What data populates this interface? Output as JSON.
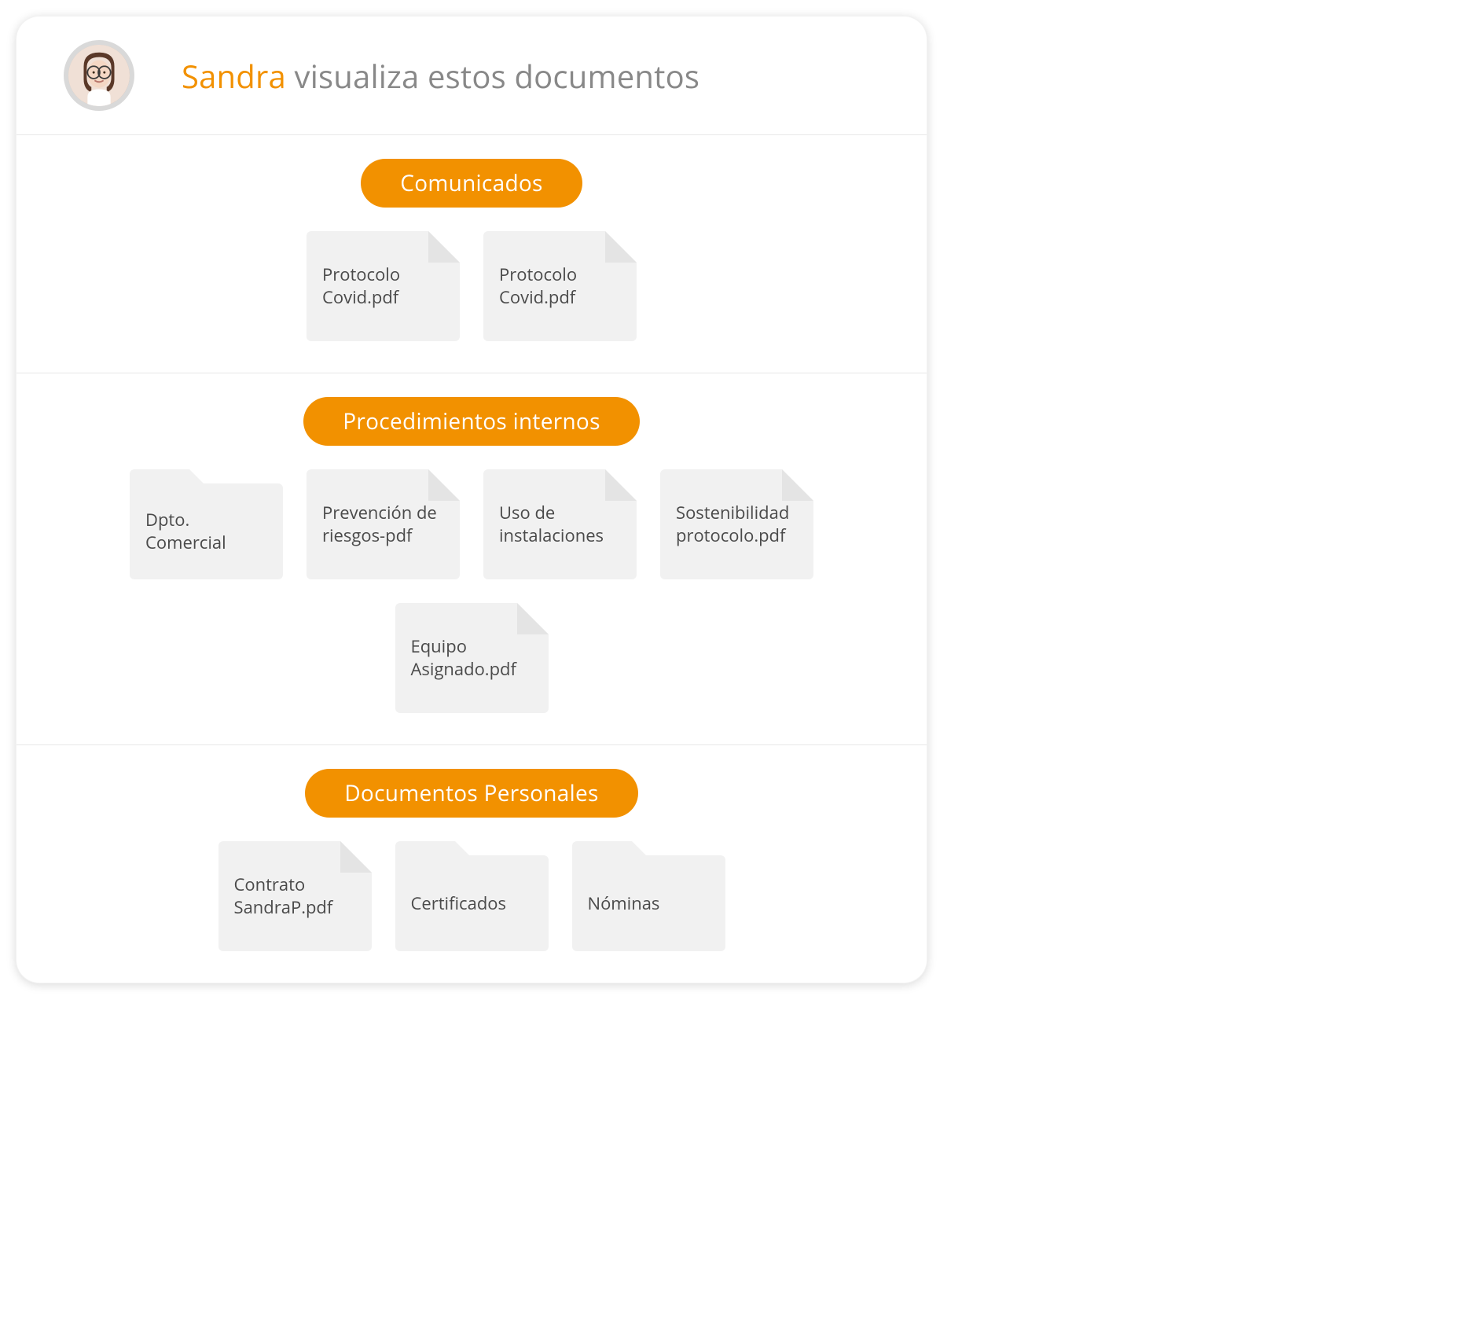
{
  "header": {
    "name": "Sandra",
    "rest": " visualiza estos documentos"
  },
  "sections": [
    {
      "title": "Comunicados",
      "items": [
        {
          "type": "file",
          "label": "Protocolo Covid.pdf"
        },
        {
          "type": "file",
          "label": "Protocolo Covid.pdf"
        }
      ]
    },
    {
      "title": "Procedimientos internos",
      "items": [
        {
          "type": "folder",
          "label": "Dpto. Comercial"
        },
        {
          "type": "file",
          "label": "Prevención de riesgos-pdf"
        },
        {
          "type": "file",
          "label": "Uso de instalaciones"
        },
        {
          "type": "file",
          "label": "Sostenibilidad protocolo.pdf"
        },
        {
          "type": "file",
          "label": "Equipo Asignado.pdf"
        }
      ]
    },
    {
      "title": "Documentos Personales",
      "items": [
        {
          "type": "file",
          "label": "Contrato SandraP.pdf"
        },
        {
          "type": "folder",
          "label": "Certificados"
        },
        {
          "type": "folder",
          "label": "Nóminas"
        }
      ]
    }
  ],
  "colors": {
    "accent": "#f29100",
    "muted": "#888888",
    "itemBg": "#f1f1f1"
  }
}
